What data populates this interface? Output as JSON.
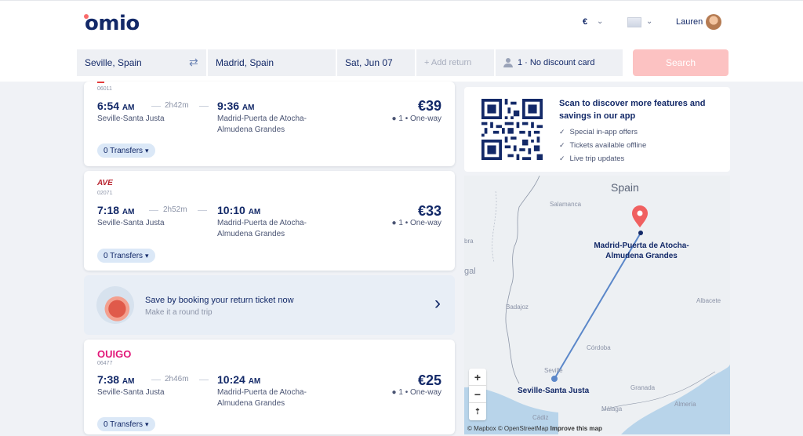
{
  "header": {
    "logo": "omio",
    "currency": "€",
    "user_name": "Lauren",
    "accent": "#fa6b6b"
  },
  "search": {
    "from": "Seville, Spain",
    "to": "Madrid, Spain",
    "date": "Sat, Jun 07",
    "return_placeholder": "+ Add return",
    "passengers": "1 · No discount card",
    "button_label": "Search"
  },
  "results": [
    {
      "carrier": "",
      "code": "06011",
      "dep_time": "6:54",
      "dep_ampm": "AM",
      "duration": "2h42m",
      "arr_time": "9:36",
      "arr_ampm": "AM",
      "origin": "Seville-Santa Justa",
      "dest_line1": "Madrid-Puerta de Atocha-",
      "dest_line2": "Almudena Grandes",
      "price": "€39",
      "pax": "1",
      "trip_type": "One-way",
      "transfers": "0 Transfers"
    },
    {
      "carrier": "AVE",
      "code": "02071",
      "dep_time": "7:18",
      "dep_ampm": "AM",
      "duration": "2h52m",
      "arr_time": "10:10",
      "arr_ampm": "AM",
      "origin": "Seville-Santa Justa",
      "dest_line1": "Madrid-Puerta de Atocha-",
      "dest_line2": "Almudena Grandes",
      "price": "€33",
      "pax": "1",
      "trip_type": "One-way",
      "transfers": "0 Transfers"
    },
    {
      "carrier": "OUIGO",
      "code": "06477",
      "dep_time": "7:38",
      "dep_ampm": "AM",
      "duration": "2h46m",
      "arr_time": "10:24",
      "arr_ampm": "AM",
      "origin": "Seville-Santa Justa",
      "dest_line1": "Madrid-Puerta de Atocha-",
      "dest_line2": "Almudena Grandes",
      "price": "€25",
      "pax": "1",
      "trip_type": "One-way",
      "transfers": "0 Transfers"
    }
  ],
  "promo": {
    "title": "Save by booking your return ticket now",
    "subtitle": "Make it a round trip"
  },
  "app_panel": {
    "title": "Scan to discover more features and savings in our app",
    "items": [
      "Special in-app offers",
      "Tickets available offline",
      "Live trip updates"
    ]
  },
  "map": {
    "country": "Spain",
    "destination_line1": "Madrid-Puerta de Atocha-",
    "destination_line2": "Almudena Grandes",
    "origin": "Seville-Santa Justa",
    "places": {
      "salamanca": "Salamanca",
      "badajoz": "Badajoz",
      "albacete": "Albacete",
      "cordoba": "Córdoba",
      "sevilla": "Seville",
      "granada": "Granada",
      "malaga": "Málaga",
      "almeria": "Almería",
      "cadiz": "Cádiz",
      "bra": "bra",
      "gal": "gal"
    },
    "attribution_mapbox": "© Mapbox",
    "attribution_osm": "© OpenStreetMap",
    "attribution_improve": "Improve this map",
    "zoom_in": "+",
    "zoom_out": "−"
  }
}
